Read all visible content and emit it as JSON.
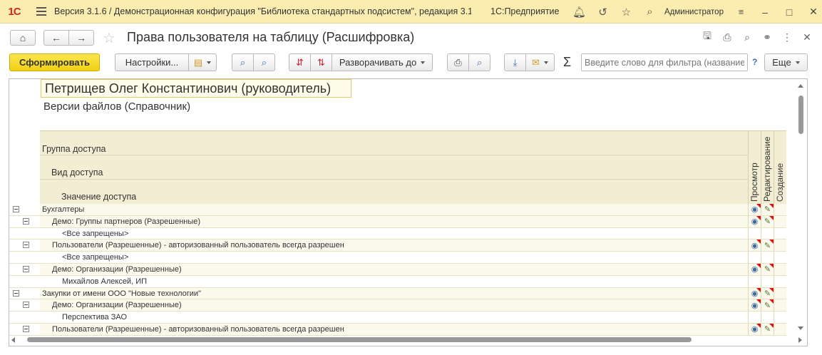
{
  "titlebar": {
    "logo": "1С",
    "title": "Версия 3.1.6 / Демонстрационная конфигурация \"Библиотека стандартных подсистем\", редакция 3.1",
    "app_name": "1С:Предприятие",
    "user": "Администратор",
    "icons": [
      "bell-icon",
      "history-icon",
      "star-icon",
      "search-icon",
      "settings-icon"
    ]
  },
  "form": {
    "title": "Права пользователя на таблицу (Расшифровка)"
  },
  "toolbar": {
    "generate": "Сформировать",
    "settings": "Настройки...",
    "expand_to": "Разворачивать до",
    "filter_placeholder": "Введите слово для фильтра (название...",
    "help": "?",
    "more": "Еще",
    "sigma": "Σ"
  },
  "report": {
    "user": "Петрищев Олег Константинович (руководитель)",
    "subtitle": "Версии файлов (Справочник)",
    "headers": {
      "group": "Группа доступа",
      "kind": "Вид доступа",
      "value": "Значение доступа",
      "columns": [
        "Просмотр",
        "Редактирование",
        "Создание"
      ]
    },
    "rows": [
      {
        "text": "Бухгалтеры",
        "level": 0,
        "toggle": true,
        "icons": true,
        "tint": true
      },
      {
        "text": "Демо: Группы партнеров (Разрешенные)",
        "level": 1,
        "toggle": true,
        "icons": true,
        "tint": true
      },
      {
        "text": "<Все запрещены>",
        "level": 2,
        "toggle": false,
        "icons": false,
        "tint": false
      },
      {
        "text": "Пользователи (Разрешенные) - авторизованный пользователь всегда разрешен",
        "level": 1,
        "toggle": true,
        "icons": true,
        "tint": true
      },
      {
        "text": "<Все запрещены>",
        "level": 2,
        "toggle": false,
        "icons": false,
        "tint": false
      },
      {
        "text": "Демо: Организации (Разрешенные)",
        "level": 1,
        "toggle": true,
        "icons": true,
        "tint": true
      },
      {
        "text": "Михайлов Алексей, ИП",
        "level": 2,
        "toggle": false,
        "icons": false,
        "tint": false
      },
      {
        "text": "Закупки от имени ООО \"Новые технологии\"",
        "level": 0,
        "toggle": true,
        "icons": true,
        "tint": true
      },
      {
        "text": "Демо: Организации (Разрешенные)",
        "level": 1,
        "toggle": true,
        "icons": true,
        "tint": true
      },
      {
        "text": "Перспектива ЗАО",
        "level": 2,
        "toggle": false,
        "icons": false,
        "tint": false
      },
      {
        "text": "Пользователи (Разрешенные) - авторизованный пользователь всегда разрешен",
        "level": 1,
        "toggle": true,
        "icons": true,
        "tint": true
      }
    ]
  },
  "colors": {
    "titlebar_bg": "#fbedb0",
    "primary_button": "#f1d014",
    "header_bg": "#f3eed3",
    "flag": "#e01010"
  }
}
